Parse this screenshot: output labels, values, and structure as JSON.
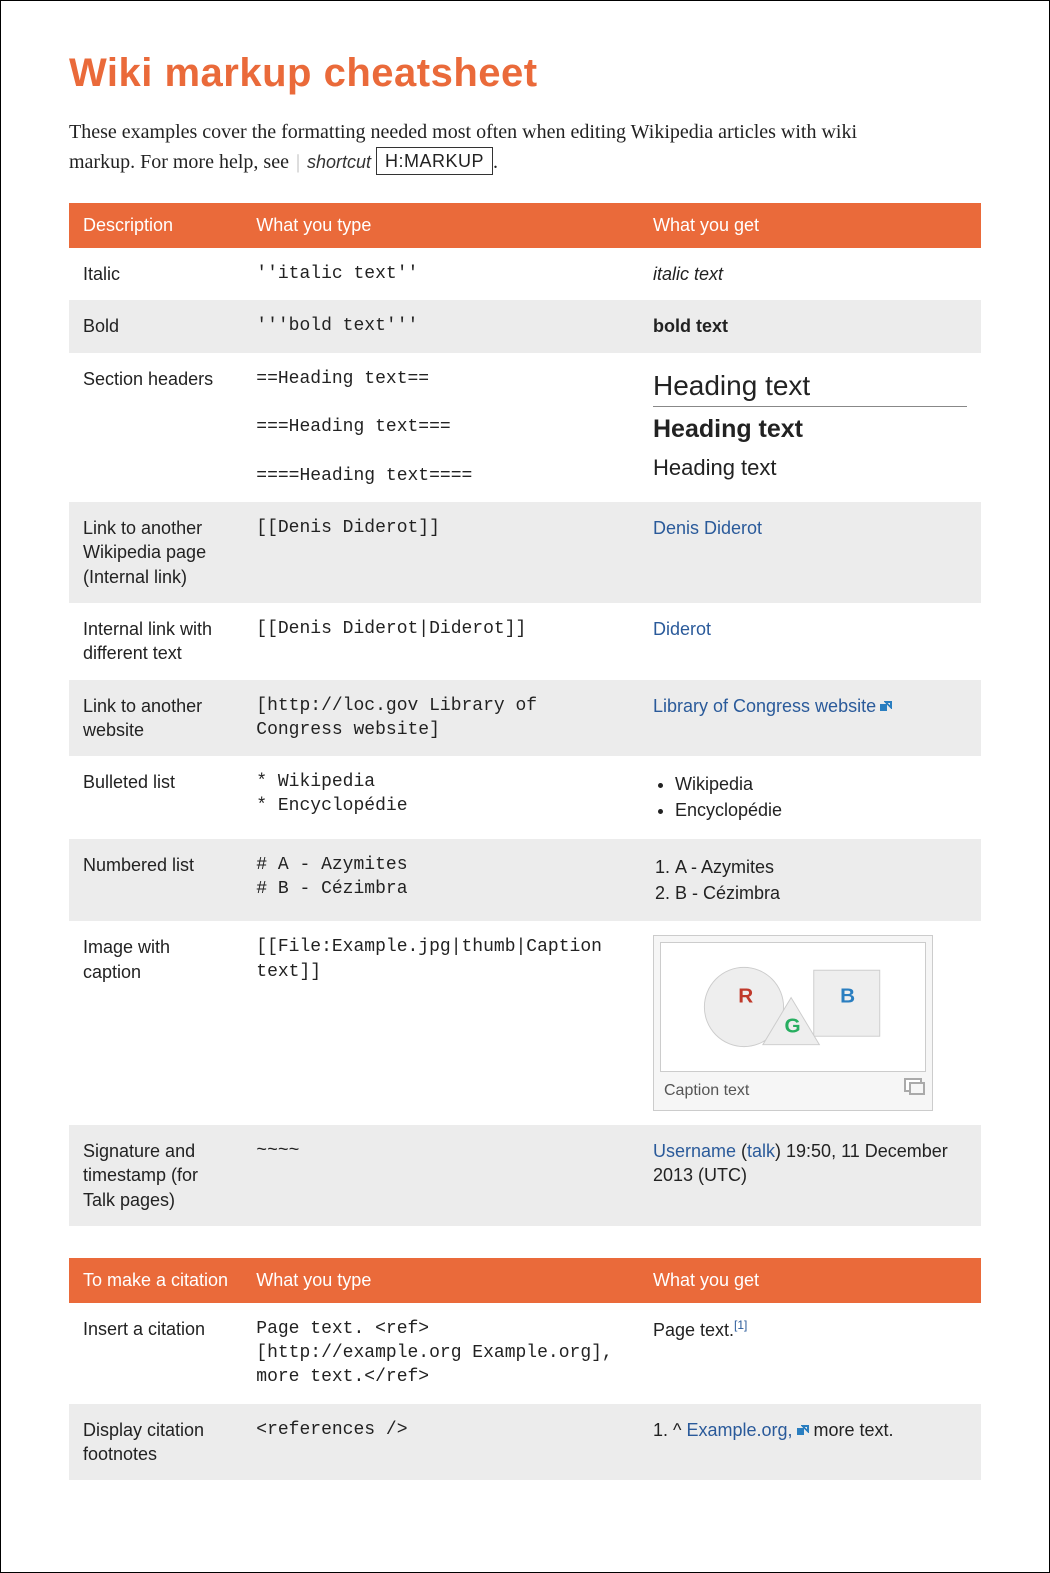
{
  "title": "Wiki markup cheatsheet",
  "intro": {
    "text": "These examples cover the formatting needed most often when editing Wikipedia articles with wiki markup. For more help, see",
    "shortcut_label": "shortcut",
    "shortcut_code": "H:MARKUP"
  },
  "tables": {
    "main": {
      "headers": [
        "Description",
        "What you type",
        "What you get"
      ],
      "rows": {
        "italic": {
          "desc": "Italic",
          "code": "''italic text''",
          "render": "italic text"
        },
        "bold": {
          "desc": "Bold",
          "code": "'''bold text'''",
          "render": "bold text"
        },
        "headers": {
          "desc": "Section headers",
          "code2": "==Heading text==",
          "code3": "===Heading text===",
          "code4": "====Heading text====",
          "render2": "Heading text",
          "render3": "Heading text",
          "render4": "Heading text"
        },
        "internal": {
          "desc": "Link to another Wikipedia page (Internal link)",
          "code": "[[Denis Diderot]]",
          "render": "Denis Diderot"
        },
        "internal_piped": {
          "desc": "Internal link with different text",
          "code": "[[Denis Diderot|Diderot]]",
          "render": "Diderot"
        },
        "external": {
          "desc": "Link to another website",
          "code": "[http://loc.gov Library of Congress website]",
          "render": "Library of Congress website"
        },
        "bulleted": {
          "desc": "Bulleted list",
          "code": "* Wikipedia\n* Encyclopédie",
          "items": [
            "Wikipedia",
            "Encyclopédie"
          ]
        },
        "numbered": {
          "desc": "Numbered list",
          "code": "# A - Azymites\n# B - Cézimbra",
          "items": [
            "A - Azymites",
            "B - Cézimbra"
          ]
        },
        "image": {
          "desc": "Image with caption",
          "code": "[[File:Example.jpg|thumb|Caption text]]",
          "caption": "Caption text",
          "shapes": {
            "R": "R",
            "G": "G",
            "B": "B"
          }
        },
        "signature": {
          "desc": "Signature and timestamp (for Talk pages)",
          "code": "~~~~",
          "username": "Username",
          "talk": "talk",
          "timestamp": ") 19:50, 11 December 2013 (UTC)"
        }
      }
    },
    "citation": {
      "headers": [
        "To make a citation",
        "What you type",
        "What you get"
      ],
      "rows": {
        "insert": {
          "desc": "Insert a citation",
          "code": "Page text. <ref>[http://example.org Example.org], more text.</ref>",
          "render_text": "Page text.",
          "ref": "[1]"
        },
        "display": {
          "desc": "Display citation footnotes",
          "code": "<references />",
          "prefix": "1. ^ ",
          "link": "Example.org,",
          "suffix": " more text."
        }
      }
    }
  }
}
